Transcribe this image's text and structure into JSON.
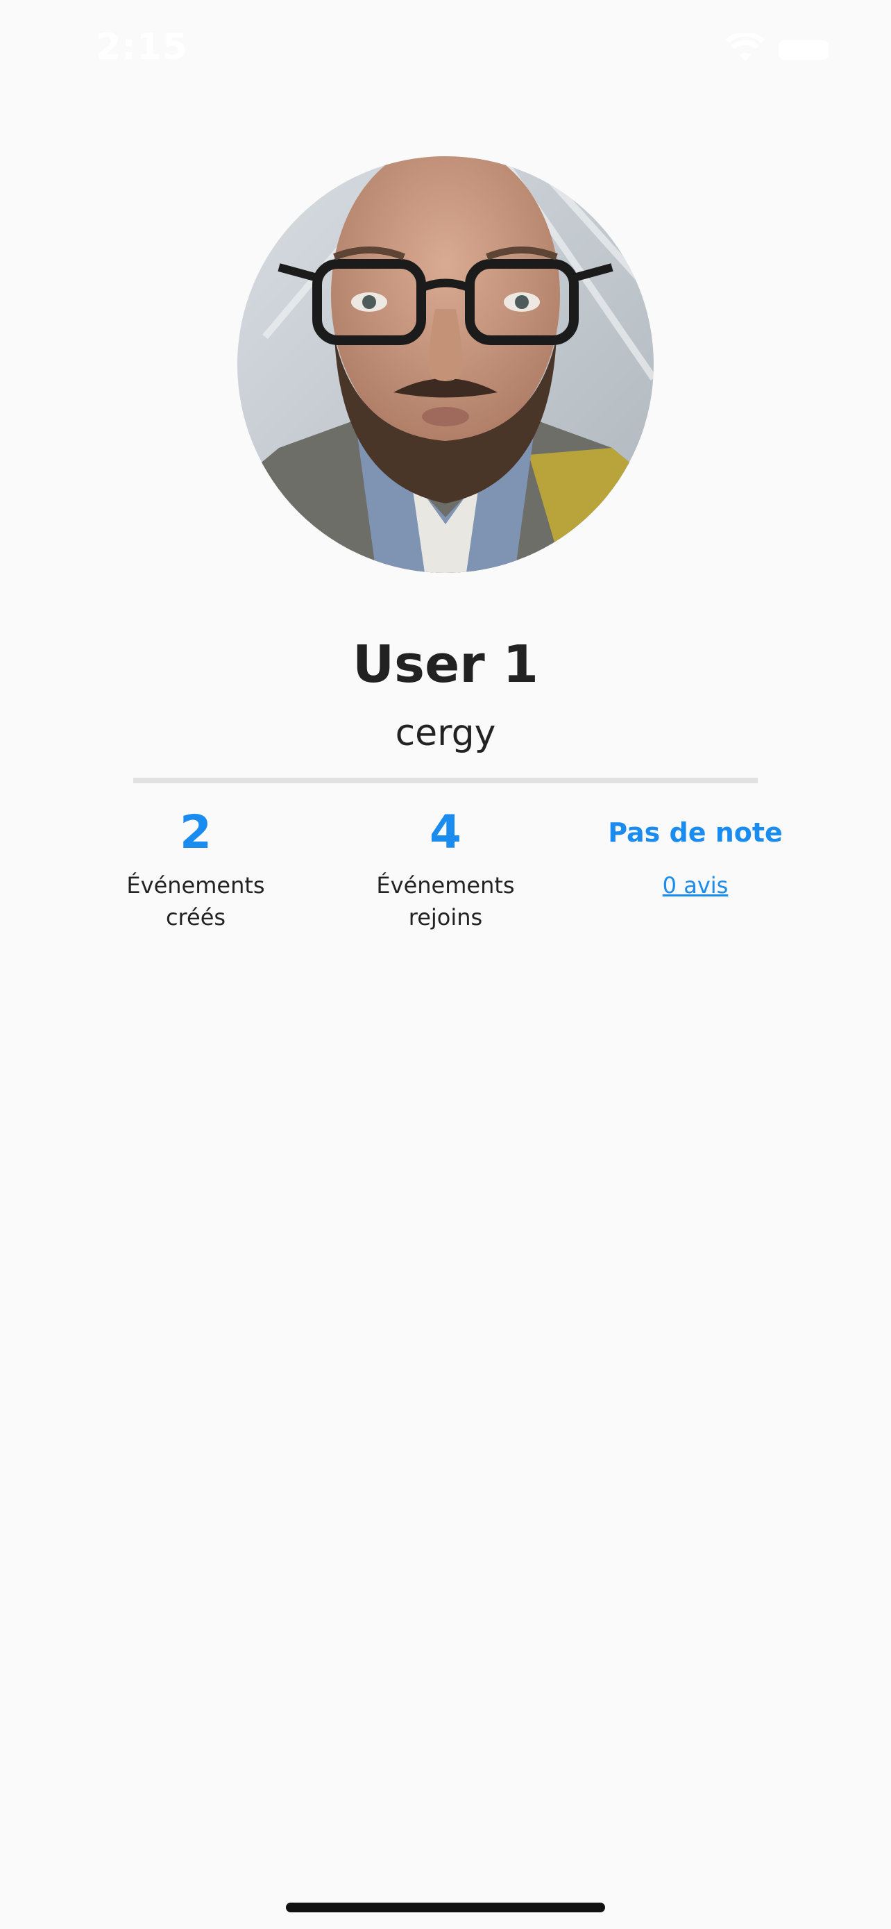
{
  "status_bar": {
    "time": "2:15",
    "icons": [
      "wifi-icon",
      "battery-icon"
    ]
  },
  "profile": {
    "name": "User 1",
    "city": "cergy"
  },
  "stats": {
    "events_created": {
      "value": "2",
      "label": "Événements\ncréés"
    },
    "events_joined": {
      "value": "4",
      "label": "Événements\nrejoins"
    },
    "rating": {
      "value": "Pas de note",
      "reviews_link": "0 avis"
    }
  },
  "colors": {
    "accent": "#1a8cf0",
    "background": "#fafafa",
    "text": "#222222",
    "divider": "#e1e1e1"
  }
}
